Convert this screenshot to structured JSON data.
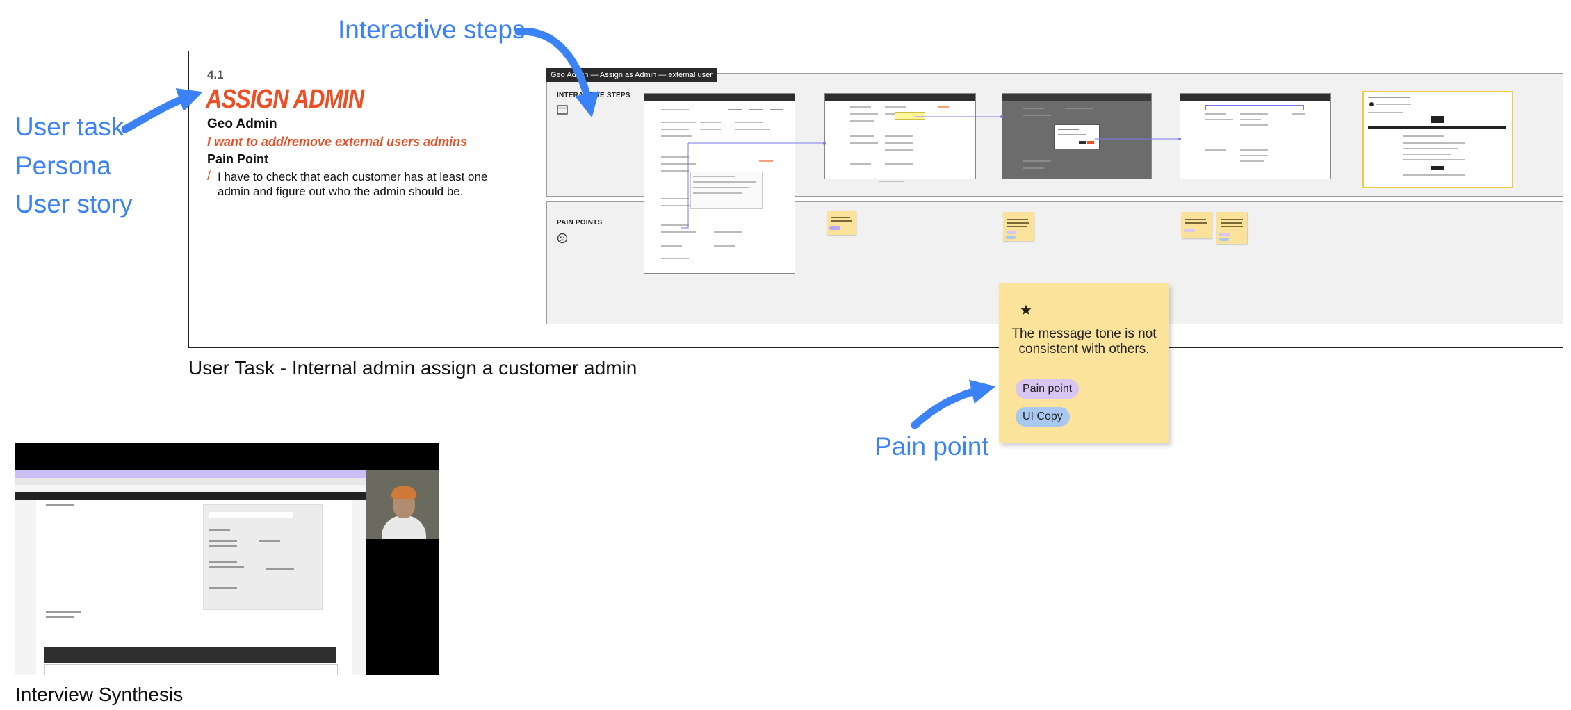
{
  "annotations": {
    "interactive_steps": "Interactive steps",
    "user_task": "User task",
    "persona": "Persona",
    "user_story": "User story",
    "pain_point": "Pain point"
  },
  "task_card": {
    "number": "4.1",
    "title": "ASSIGN ADMIN",
    "persona": "Geo Admin",
    "story": "I want to add/remove external users admins",
    "pain_heading": "Pain Point",
    "pain_slash": "/",
    "pain_text": "I have to check that each customer has at least one admin and figure out who the admin should be."
  },
  "frame_caption": "User Task - Internal admin assign a customer admin",
  "swimlanes": {
    "tooltip": "Geo Admin — Assign as Admin — external user",
    "interactive_label": "INTERACTIVE STEPS",
    "pain_label": "PAIN POINTS",
    "icons": {
      "steps": "window-icon",
      "pain": "frown-face-icon"
    }
  },
  "pain_sticky": {
    "icon": "star-icon",
    "star": "★",
    "message": "The message tone is not consistent with others.",
    "tags": [
      {
        "label": "Pain point",
        "color": "#d9c5f2"
      },
      {
        "label": "UI Copy",
        "color": "#a9c8f0"
      }
    ]
  },
  "video_caption": "Interview Synthesis",
  "colors": {
    "annotation_blue": "#3b82f6",
    "accent_orange": "#ee4e23",
    "sticky_yellow": "#fbe39b",
    "lane_grey": "#f1f1f1"
  }
}
